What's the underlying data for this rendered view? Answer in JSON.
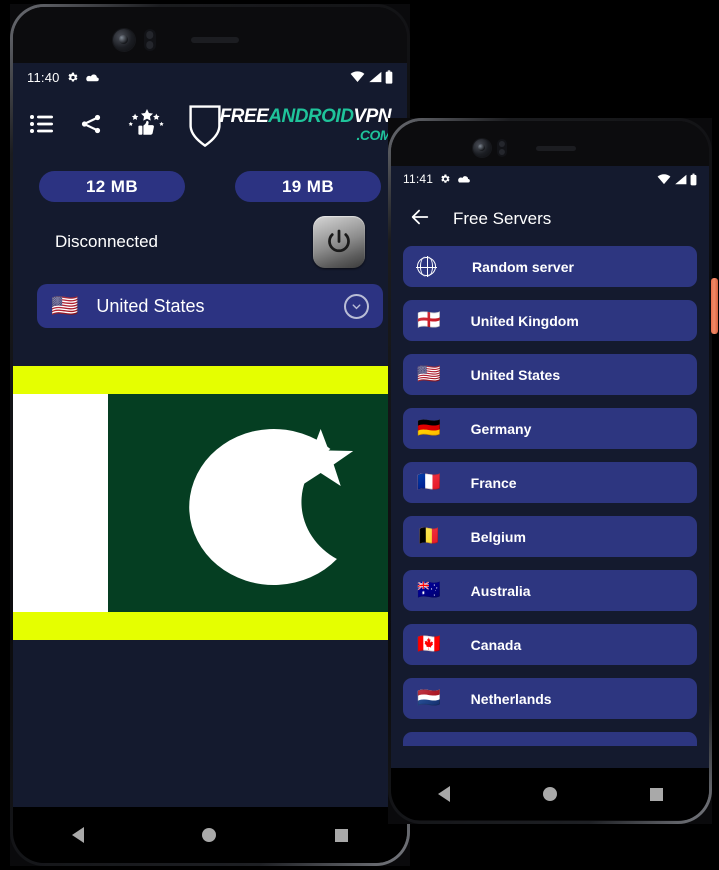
{
  "background_color": "#000000",
  "colors": {
    "screen_bg": "#141a2e",
    "accent_pill": "#2c3382",
    "list_item": "#2d3680",
    "logo_teal": "#1fc39a",
    "banner_yellow": "#e5ff00",
    "flag_green": "#053e22",
    "side_button": "#e8704d"
  },
  "phone1": {
    "status_bar": {
      "time": "11:40",
      "icons_left": [
        "gear-icon",
        "cloud-icon"
      ],
      "icons_right": [
        "wifi-icon",
        "signal-icon",
        "battery-icon"
      ]
    },
    "toolbar": {
      "icons": [
        "menu-list-icon",
        "share-icon",
        "rate-us-icon"
      ],
      "logo": {
        "free": "FREE",
        "android": "ANDROID",
        "vpn": "VPN",
        "com": ".COM"
      }
    },
    "stats": {
      "download": "12 MB",
      "upload": "19 MB"
    },
    "connection": {
      "status": "Disconnected",
      "power_button": "power-icon"
    },
    "country_selector": {
      "flag": "🇺🇸",
      "name": "United States",
      "chevron": "chevron-down-icon"
    },
    "banner": {
      "type": "pakistan-flag-ad",
      "top_bar_color": "#e5ff00",
      "bottom_bar_color": "#e5ff00"
    },
    "nav_bar": [
      "back-button",
      "home-button",
      "recents-button"
    ]
  },
  "phone2": {
    "status_bar": {
      "time": "11:41",
      "icons_left": [
        "gear-icon",
        "cloud-icon"
      ],
      "icons_right": [
        "wifi-icon",
        "signal-icon",
        "battery-icon"
      ]
    },
    "app_bar": {
      "back": "back-arrow-icon",
      "title": "Free Servers"
    },
    "servers": [
      {
        "flag": "globe",
        "label": "Random server"
      },
      {
        "flag": "🏴󠁧󠁢󠁥󠁮󠁧󠁿",
        "label": "United Kingdom"
      },
      {
        "flag": "🇺🇸",
        "label": "United States"
      },
      {
        "flag": "🇩🇪",
        "label": "Germany"
      },
      {
        "flag": "🇫🇷",
        "label": "France"
      },
      {
        "flag": "🇧🇪",
        "label": "Belgium"
      },
      {
        "flag": "🇦🇺",
        "label": "Australia"
      },
      {
        "flag": "🇨🇦",
        "label": "Canada"
      },
      {
        "flag": "🇳🇱",
        "label": "Netherlands"
      },
      {
        "flag": "",
        "label": ""
      }
    ],
    "nav_bar": [
      "back-button",
      "home-button",
      "recents-button"
    ]
  }
}
